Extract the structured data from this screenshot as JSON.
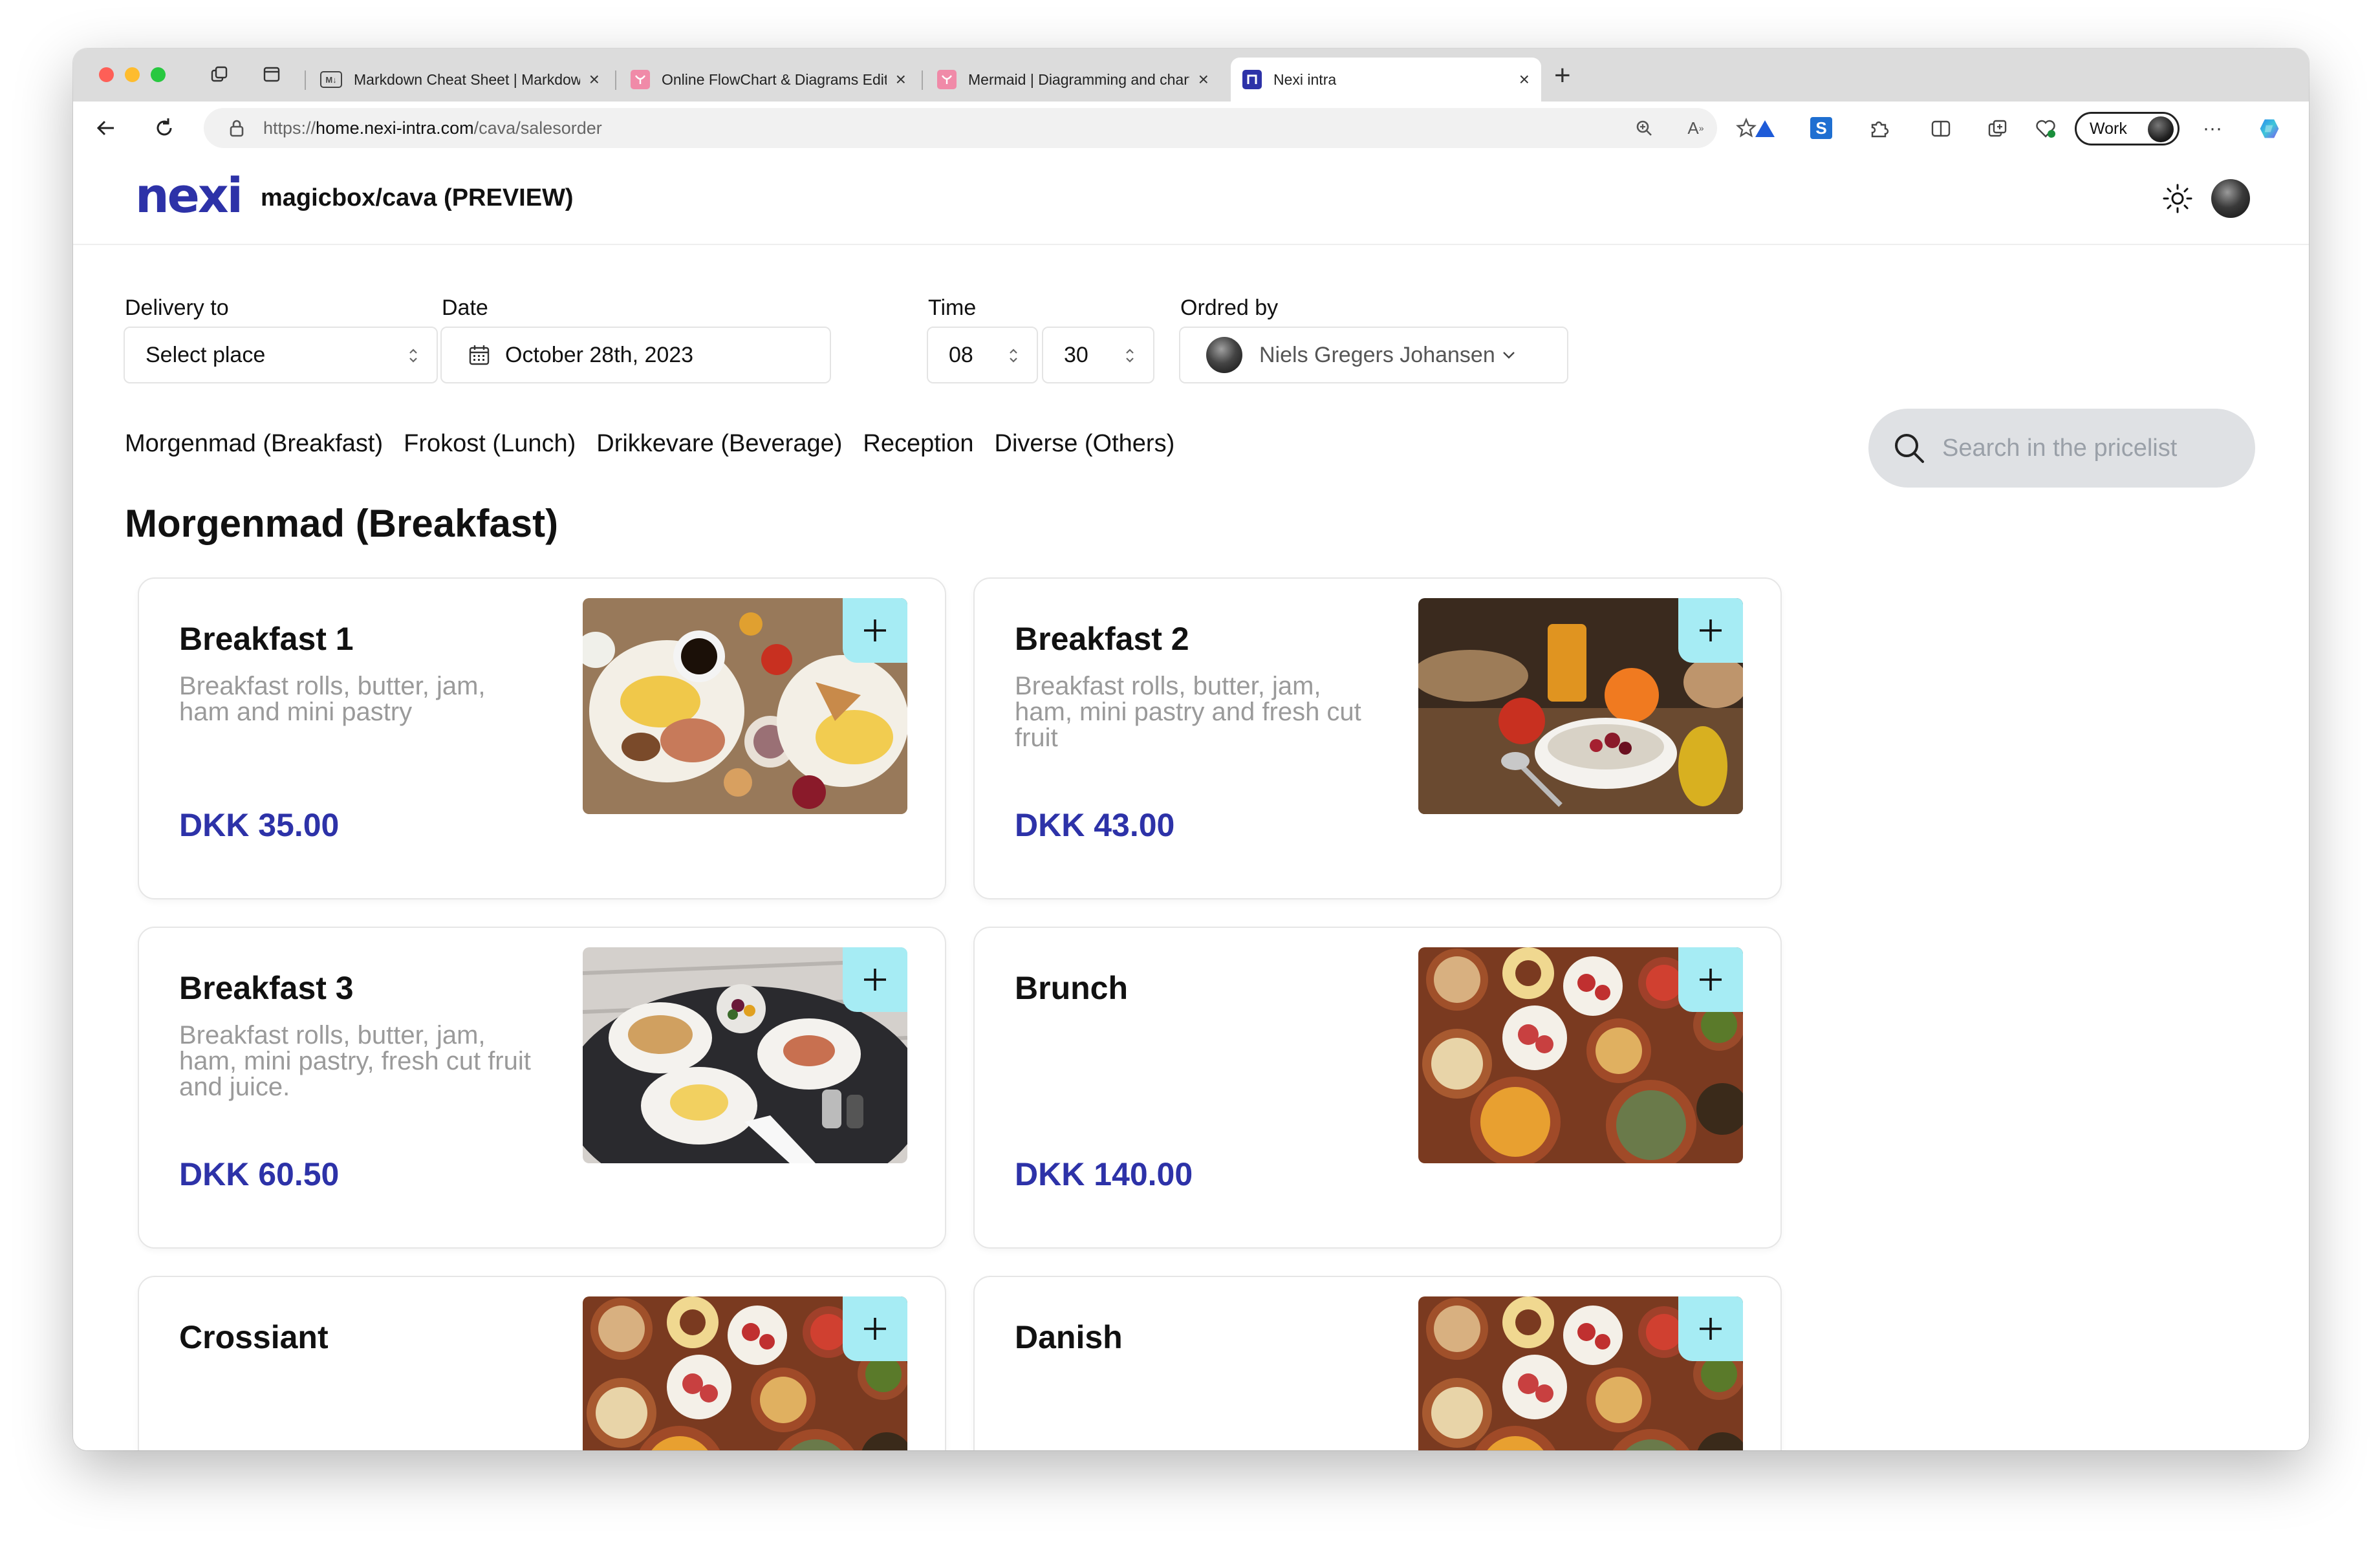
{
  "browser": {
    "tabs": [
      {
        "title": "Markdown Cheat Sheet | Markdown Guide",
        "active": false
      },
      {
        "title": "Online FlowChart & Diagrams Editor",
        "active": false
      },
      {
        "title": "Mermaid | Diagramming and charting tool",
        "active": false
      },
      {
        "title": "Nexi intra",
        "active": true
      }
    ],
    "url_scheme": "https://",
    "url_host": "home.nexi-intra.com",
    "url_path": "/cava/salesorder",
    "profile_label": "Work"
  },
  "header": {
    "logo_text": "nexi",
    "app_title": "magicbox/cava (PREVIEW)"
  },
  "form": {
    "delivery_label": "Delivery to",
    "delivery_value": "Select place",
    "date_label": "Date",
    "date_value": "October 28th, 2023",
    "time_label": "Time",
    "hour_value": "08",
    "minute_value": "30",
    "ordered_by_label": "Ordred by",
    "ordered_by_value": "Niels Gregers Johansen"
  },
  "categories": [
    "Morgenmad (Breakfast)",
    "Frokost (Lunch)",
    "Drikkevare (Beverage)",
    "Reception",
    "Diverse (Others)"
  ],
  "search": {
    "placeholder": "Search in the pricelist"
  },
  "section_title": "Morgenmad (Breakfast)",
  "products": [
    {
      "name": "Breakfast 1",
      "description": "Breakfast rolls, butter, jam, ham and mini pastry",
      "price": "DKK 35.00",
      "image": "breakfast-platter"
    },
    {
      "name": "Breakfast 2",
      "description": "Breakfast rolls, butter, jam, ham, mini pastry and fresh cut fruit",
      "price": "DKK 43.00",
      "image": "fruit-juice"
    },
    {
      "name": "Breakfast 3",
      "description": "Breakfast rolls, butter, jam, ham, mini pastry, fresh cut fruit and juice.",
      "price": "DKK 60.50",
      "image": "table-setting"
    },
    {
      "name": "Brunch",
      "description": "",
      "price": "DKK 140.00",
      "image": "tapas"
    },
    {
      "name": "Crossiant",
      "description": "",
      "price": "",
      "image": "tapas"
    },
    {
      "name": "Danish",
      "description": "",
      "price": "",
      "image": "tapas"
    }
  ],
  "colors": {
    "brand": "#2d32a8",
    "add_button": "#a6ecf4",
    "muted_text": "#9a9a9a"
  }
}
